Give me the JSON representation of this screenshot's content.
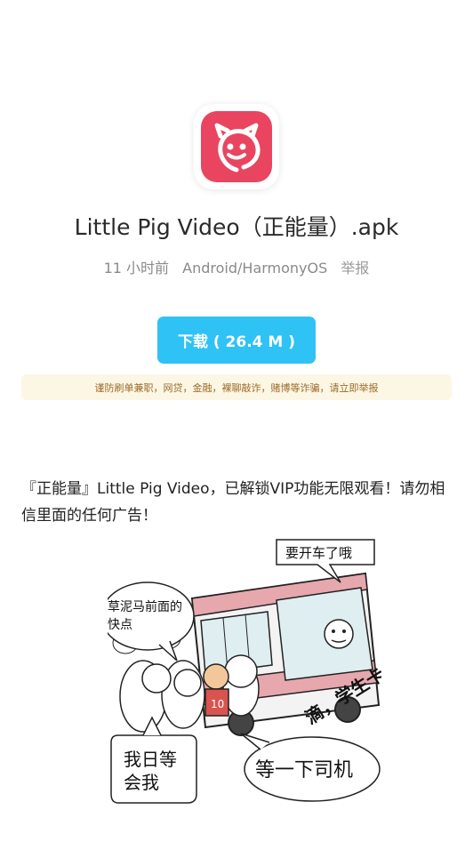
{
  "app": {
    "file_name": "Little Pig Video（正能量）.apk",
    "time_ago": "11 小时前",
    "platform": "Android/HarmonyOS",
    "report_label": "举报"
  },
  "download": {
    "label": "下载 ( 26.4 M )"
  },
  "warning": {
    "text": "谨防刷单兼职，网贷，金融，裸聊敲诈，赌博等诈骗，请立即举报"
  },
  "description": {
    "text": "『正能量』Little Pig Video，已解锁VIP功能无限观看！请勿相信里面的任何广告！"
  },
  "image": {
    "speech_top_right": "要开车了哦",
    "speech_left": "草泥马前面的快点",
    "speech_bottom_left": "我日等会我",
    "speech_bottom_right": "等一下司机",
    "bus_text": "滴，学生卡",
    "shirt_number": "10"
  },
  "colors": {
    "accent": "#2fc2f5",
    "icon": "#e94560",
    "warning_bg": "#fcf6e4",
    "warning_text": "#9a6b2a"
  }
}
